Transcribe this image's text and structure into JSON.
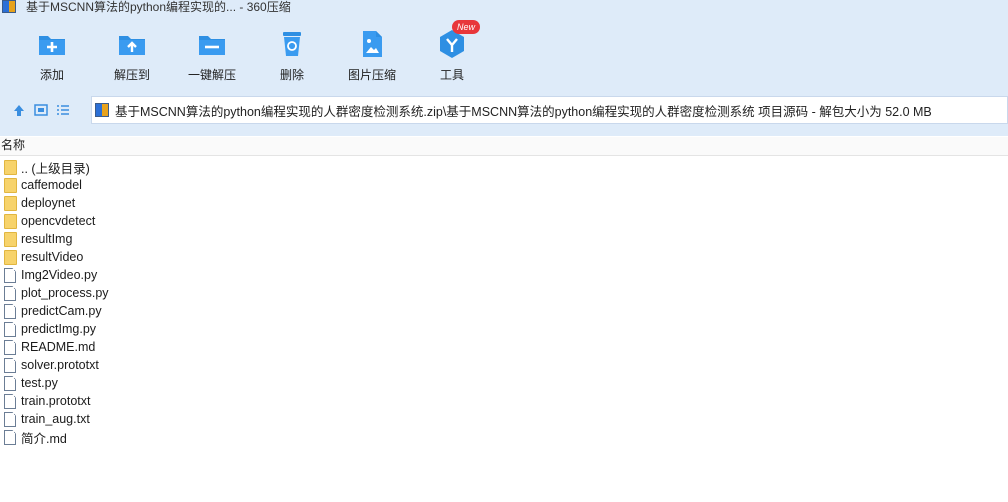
{
  "window": {
    "title": "基于MSCNN算法的python编程实现的... - 360压缩"
  },
  "toolbar": {
    "items": [
      {
        "label": "添加",
        "icon": "add-icon"
      },
      {
        "label": "解压到",
        "icon": "extract-to-icon"
      },
      {
        "label": "一键解压",
        "icon": "one-click-extract-icon"
      },
      {
        "label": "删除",
        "icon": "trash-icon"
      },
      {
        "label": "图片压缩",
        "icon": "image-compress-icon"
      },
      {
        "label": "工具",
        "icon": "tools-icon"
      }
    ],
    "badge": "New",
    "accent": "#2e8fe3"
  },
  "address": {
    "path": "基于MSCNN算法的python编程实现的人群密度检测系统.zip\\基于MSCNN算法的python编程实现的人群密度检测系统 项目源码 - 解包大小为 52.0 MB"
  },
  "columns": {
    "name": "名称"
  },
  "files": [
    {
      "name": ".. (上级目录)",
      "type": "folder"
    },
    {
      "name": "caffemodel",
      "type": "folder"
    },
    {
      "name": "deploynet",
      "type": "folder"
    },
    {
      "name": "opencvdetect",
      "type": "folder"
    },
    {
      "name": "resultImg",
      "type": "folder"
    },
    {
      "name": "resultVideo",
      "type": "folder"
    },
    {
      "name": "Img2Video.py",
      "type": "file"
    },
    {
      "name": "plot_process.py",
      "type": "file"
    },
    {
      "name": "predictCam.py",
      "type": "file"
    },
    {
      "name": "predictImg.py",
      "type": "file"
    },
    {
      "name": "README.md",
      "type": "file"
    },
    {
      "name": "solver.prototxt",
      "type": "file"
    },
    {
      "name": "test.py",
      "type": "file"
    },
    {
      "name": "train.prototxt",
      "type": "file"
    },
    {
      "name": "train_aug.txt",
      "type": "file"
    },
    {
      "name": "简介.md",
      "type": "file"
    }
  ]
}
